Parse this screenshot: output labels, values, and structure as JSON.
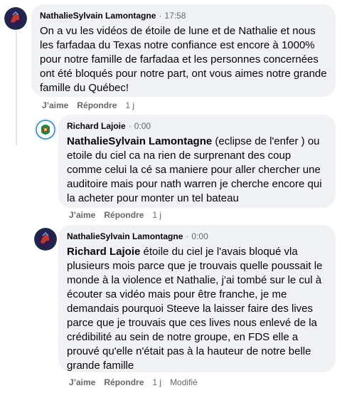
{
  "comments": [
    {
      "author": "NathalieSylvain Lamontagne",
      "time": "17:58",
      "text": "On a vu les vidéos de étoile de lune et de Nathalie et nous les farfadaa du Texas notre confiance est encore à 1000% pour notre famille de farfadaa et les personnes concernées ont été bloqués pour notre part, ont vous aimes notre grande famille du Québec!",
      "like_label": "J’aime",
      "reply_label": "Répondre",
      "age": "1 j"
    },
    {
      "author": "Richard Lajoie",
      "time": "0:00",
      "mention": "NathalieSylvain Lamontagne",
      "text": " (eclipse de l'enfer ) ou etoile du ciel ca na rien de surprenant des coup comme celui la cé sa maniere pour aller chercher une auditoire mais pour nath warren je cherche encore qui la acheter pour monter un tel bateau",
      "like_label": "J’aime",
      "reply_label": "Répondre",
      "age": "1 j"
    },
    {
      "author": "NathalieSylvain Lamontagne",
      "time": "0:00",
      "mention": "Richard Lajoie",
      "text": " étoile du ciel je l'avais bloqué vla plusieurs mois parce que je trouvais quelle poussait le monde à la violence et Nathalie, j'ai tombé sur le cul à écouter sa vidéo mais pour être franche, je me demandais pourquoi Steeve la laisser faire des lives parce que je trouvais que ces lives nous enlevé de la crédibilité au sein de notre groupe, en FDS elle a prouvé qu'elle n'était pas à la hauteur de notre belle grande famille",
      "like_label": "J’aime",
      "reply_label": "Répondre",
      "age": "1 j",
      "edited": "Modifié"
    }
  ],
  "separator": "·",
  "colors": {
    "bubble": "#f0f2f5",
    "text": "#050505",
    "muted": "#65676b"
  }
}
